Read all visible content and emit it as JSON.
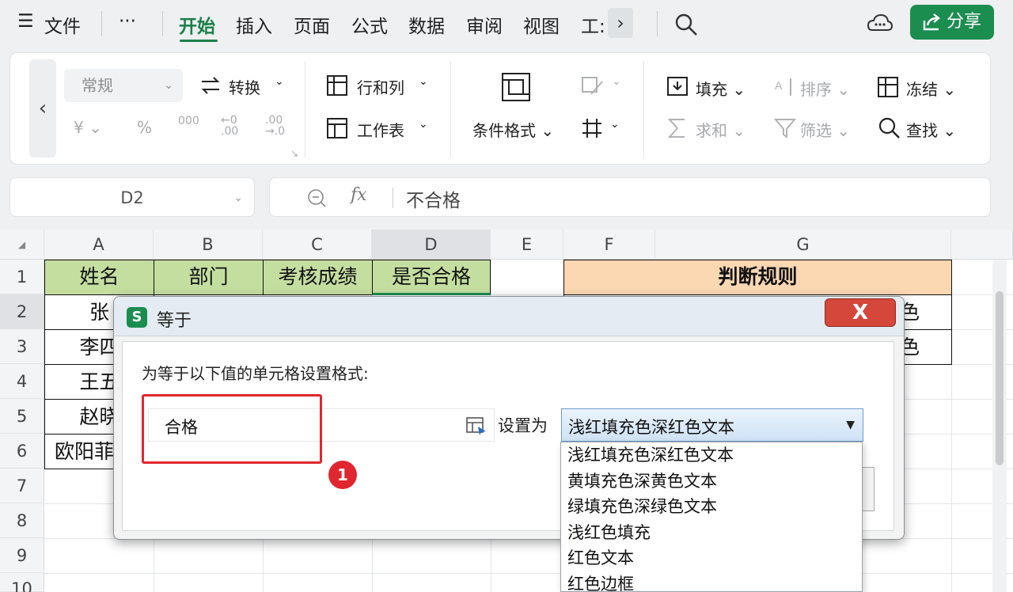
{
  "menubar": {
    "menu_icon": "☰",
    "file": "文件",
    "more": "···",
    "tabs": [
      "开始",
      "插入",
      "页面",
      "公式",
      "数据",
      "审阅",
      "视图",
      "工:"
    ],
    "active_tab": "开始",
    "share": "分享"
  },
  "ribbon": {
    "number_format": "常规",
    "convert": "转换",
    "currency": "¥",
    "percent": "%",
    "thousands": "000",
    "dec_less": "←0\n.00",
    "dec_more": ".00\n→.0",
    "row_col": "行和列",
    "worksheet": "工作表",
    "cond_format": "条件格式",
    "fill": "填充",
    "sort": "排序",
    "freeze": "冻结",
    "sum": "求和",
    "filter": "筛选",
    "find": "查找"
  },
  "formula_bar": {
    "cell_ref": "D2",
    "fx": "fx",
    "value": "不合格"
  },
  "sheet": {
    "columns": [
      "A",
      "B",
      "C",
      "D",
      "E",
      "F",
      "G"
    ],
    "rows": [
      "1",
      "2",
      "3",
      "4",
      "5",
      "6",
      "7",
      "8",
      "9",
      "10"
    ],
    "header_row": [
      "姓名",
      "部门",
      "考核成绩",
      "是否合格"
    ],
    "rule_header": "判断规则",
    "names": [
      "张",
      "李四",
      "王五",
      "赵晓",
      "欧阳菲"
    ],
    "g_partial": [
      "色",
      "色"
    ]
  },
  "dialog": {
    "logo": "S",
    "title": "等于",
    "close": "X",
    "prompt": "为等于以下值的单元格设置格式:",
    "input_value": "合格",
    "set_as_label": "设置为",
    "selected_format": "浅红填充色深红色文本",
    "badge": "1",
    "options": [
      "浅红填充色深红色文本",
      "黄填充色深黄色文本",
      "绿填充色深绿色文本",
      "浅红色填充",
      "红色文本",
      "红色边框"
    ]
  }
}
